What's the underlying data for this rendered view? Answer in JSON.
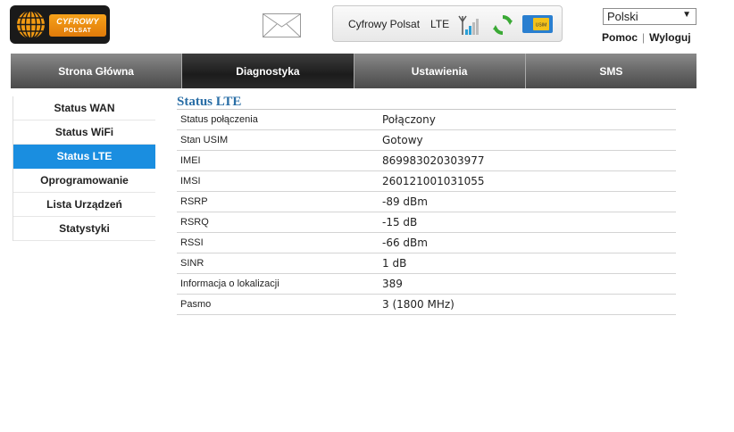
{
  "header": {
    "logo": {
      "line1": "CYFROWY",
      "line2": "POLSAT"
    },
    "status": {
      "operator": "Cyfrowy Polsat",
      "network": "LTE",
      "sim_label": "USIM"
    },
    "language": {
      "selected": "Polski"
    },
    "links": {
      "help": "Pomoc",
      "separator": "|",
      "logout": "Wyloguj"
    }
  },
  "nav": {
    "tabs": [
      {
        "label": "Strona Główna",
        "active": false
      },
      {
        "label": "Diagnostyka",
        "active": true
      },
      {
        "label": "Ustawienia",
        "active": false
      },
      {
        "label": "SMS",
        "active": false
      }
    ]
  },
  "sidebar": {
    "items": [
      {
        "label": "Status WAN",
        "active": false
      },
      {
        "label": "Status WiFi",
        "active": false
      },
      {
        "label": "Status LTE",
        "active": true
      },
      {
        "label": "Oprogramowanie",
        "active": false
      },
      {
        "label": "Lista Urządzeń",
        "active": false
      },
      {
        "label": "Statystyki",
        "active": false
      }
    ]
  },
  "main": {
    "title": "Status LTE",
    "rows": [
      {
        "key": "Status połączenia",
        "value": "Połączony"
      },
      {
        "key": "Stan USIM",
        "value": "Gotowy"
      },
      {
        "key": "IMEI",
        "value": "869983020303977"
      },
      {
        "key": "IMSI",
        "value": "260121001031055"
      },
      {
        "key": "RSRP",
        "value": "-89 dBm"
      },
      {
        "key": "RSRQ",
        "value": "-15 dB"
      },
      {
        "key": "RSSI",
        "value": "-66 dBm"
      },
      {
        "key": "SINR",
        "value": "1 dB"
      },
      {
        "key": "Informacja o lokalizacji",
        "value": "389"
      },
      {
        "key": "Pasmo",
        "value": "3 (1800 MHz)"
      }
    ]
  },
  "colors": {
    "accent": "#1a8ee0",
    "title": "#2a6ea6",
    "logo_orange": "#f6a21a",
    "refresh_green": "#3aa935"
  },
  "icons": {
    "mail": "envelope-icon",
    "signal": "signal-bars-icon",
    "refresh": "refresh-icon",
    "sim": "sim-card-icon",
    "dropdown": "chevron-down-icon"
  }
}
